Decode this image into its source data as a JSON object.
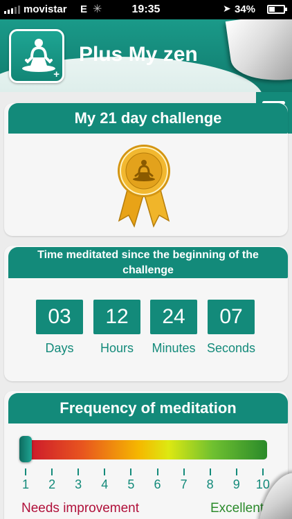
{
  "status_bar": {
    "carrier": "movistar",
    "network": "E",
    "time": "19:35",
    "battery": "34%",
    "battery_level": 0.34
  },
  "header": {
    "app_name": "Plus My zen",
    "app_icon": "meditation-figure-icon",
    "menu_icon": "hamburger-menu-icon"
  },
  "challenge": {
    "title": "My 21 day challenge",
    "badge_icon": "award-ribbon-icon"
  },
  "timer": {
    "title": "Time meditated since the beginning of the challenge",
    "units": [
      {
        "value": "03",
        "label": "Days"
      },
      {
        "value": "12",
        "label": "Hours"
      },
      {
        "value": "24",
        "label": "Minutes"
      },
      {
        "value": "07",
        "label": "Seconds"
      }
    ]
  },
  "frequency": {
    "title": "Frequency of meditation",
    "selected_value": 1,
    "scale": [
      "1",
      "2",
      "3",
      "4",
      "5",
      "6",
      "7",
      "8",
      "9",
      "10"
    ],
    "low_label": "Needs improvement",
    "high_label": "Excellent"
  },
  "colors": {
    "accent": "#138a7a",
    "gold": "#e8a317",
    "low": "#c8102e",
    "high": "#2a8a2a"
  }
}
